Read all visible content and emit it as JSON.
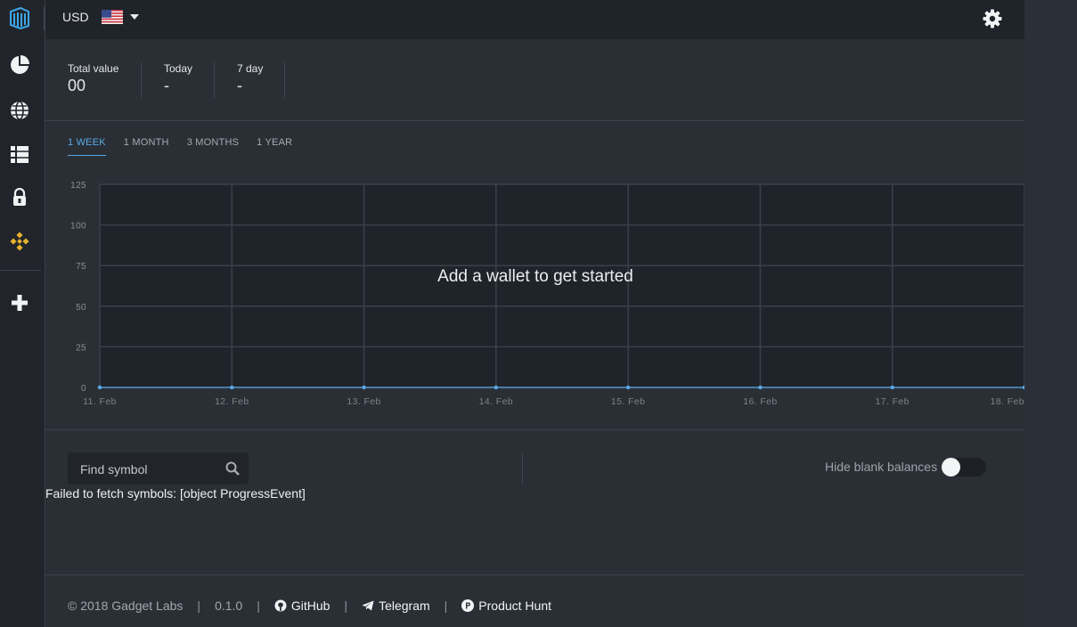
{
  "header": {
    "currency": "USD",
    "flag_icon": "us-flag-icon",
    "settings_icon": "gear-icon"
  },
  "sidebar": {
    "logo_icon": "app-logo-icon",
    "items": [
      {
        "name": "pie-chart-icon"
      },
      {
        "name": "globe-icon"
      },
      {
        "name": "list-grid-icon"
      },
      {
        "name": "lock-icon"
      },
      {
        "name": "binance-icon"
      },
      {
        "name": "add-icon"
      }
    ]
  },
  "stats": [
    {
      "label": "Total value",
      "value": "00"
    },
    {
      "label": "Today",
      "value": "-"
    },
    {
      "label": "7 day",
      "value": "-"
    }
  ],
  "tabs": [
    "1 WEEK",
    "1 MONTH",
    "3 MONTHS",
    "1 YEAR"
  ],
  "active_tab": "1 WEEK",
  "chart_data": {
    "type": "line",
    "x": [
      "11. Feb",
      "12. Feb",
      "13. Feb",
      "14. Feb",
      "15. Feb",
      "16. Feb",
      "17. Feb",
      "18. Feb"
    ],
    "y_ticks": [
      "125",
      "100",
      "75",
      "50",
      "25",
      "0"
    ],
    "ylim": [
      0,
      125
    ],
    "series": [
      {
        "values": [
          0,
          0,
          0,
          0,
          0,
          0,
          0,
          0
        ]
      }
    ],
    "message": "Add a wallet to get started",
    "grid": true,
    "colors": {
      "line": "#5aa9e6",
      "plot_bg": "#1f232a",
      "grid": "#3b4149"
    }
  },
  "search": {
    "placeholder": "Find symbol"
  },
  "error_text": "Failed to fetch symbols: [object ProgressEvent]",
  "toggle": {
    "label": "Hide blank balances",
    "on": false
  },
  "footer": {
    "copyright": "© 2018 Gadget Labs",
    "version": "0.1.0",
    "links": [
      "GitHub",
      "Telegram",
      "Product Hunt"
    ]
  },
  "colors": {
    "accent": "#5aa9e6",
    "binance": "#e8b22f"
  }
}
